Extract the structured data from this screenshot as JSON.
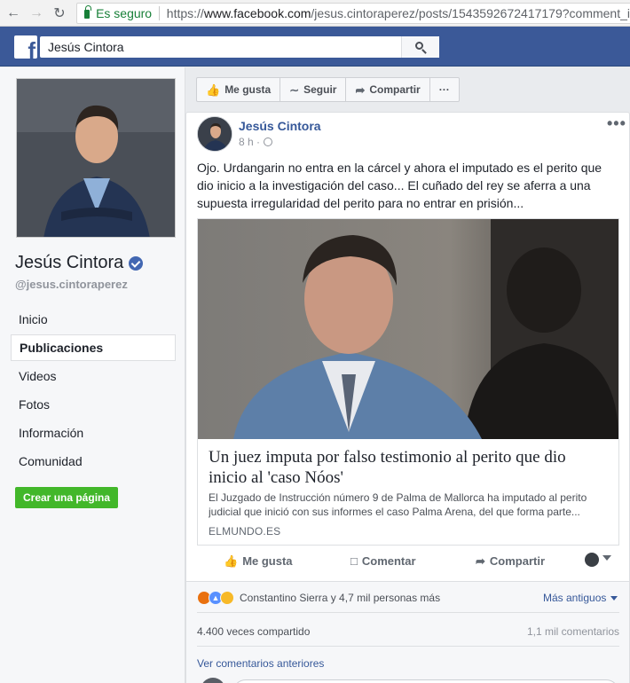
{
  "browser": {
    "secure_label": "Es seguro",
    "url_prefix": "https://",
    "url_domain": "www.facebook.com",
    "url_path": "/jesus.cintoraperez/posts/1543592672417179?comment_i",
    "back_icon": "arrow-left-icon",
    "forward_icon": "arrow-right-icon",
    "reload_icon": "reload-icon",
    "lock_icon": "lock-icon"
  },
  "fb_bar": {
    "logo_letter": "f",
    "search_value": "Jesús Cintora",
    "search_icon": "search-icon",
    "color": "#3b5998"
  },
  "page": {
    "name": "Jesús Cintora",
    "handle": "@jesus.cintoraperez",
    "verified_icon": "verified-badge-icon",
    "nav": [
      {
        "label": "Inicio",
        "active": false
      },
      {
        "label": "Publicaciones",
        "active": true
      },
      {
        "label": "Videos",
        "active": false
      },
      {
        "label": "Fotos",
        "active": false
      },
      {
        "label": "Información",
        "active": false
      },
      {
        "label": "Comunidad",
        "active": false
      }
    ],
    "create_page_label": "Crear una página",
    "create_page_color": "#42b72a"
  },
  "actions": {
    "like": "Me gusta",
    "follow": "Seguir",
    "share": "Compartir",
    "more": "···"
  },
  "post": {
    "author": "Jesús Cintora",
    "time": "8 h",
    "time_sep": "·",
    "text": "Ojo. Urdangarin no entra en la cárcel y ahora el imputado es el perito que dio inicio a la investigación del caso... El cuñado del rey se aferra a una supuesta irregularidad del perito para no entrar en prisión...",
    "more": "•••",
    "link": {
      "title": "Un juez imputa por falso testimonio al perito que dio inicio al 'caso Nóos'",
      "description": "El Juzgado de Instrucción número 9 de Palma de Mallorca ha imputado al perito judicial que inició con sus informes el caso Palma Arena, del que forma parte...",
      "domain": "ELMUNDO.ES"
    },
    "ufi": {
      "like": "Me gusta",
      "comment": "Comentar",
      "share": "Compartir"
    },
    "reactions": {
      "icons": [
        "angry-reaction-icon",
        "like-reaction-icon",
        "haha-reaction-icon"
      ],
      "text": "Constantino Sierra y 4,7 mil personas más",
      "sort": "Más antiguos"
    },
    "shares": "4.400 veces compartido",
    "comments": "1,1 mil comentarios",
    "previous_comments": "Ver comentarios anteriores"
  }
}
